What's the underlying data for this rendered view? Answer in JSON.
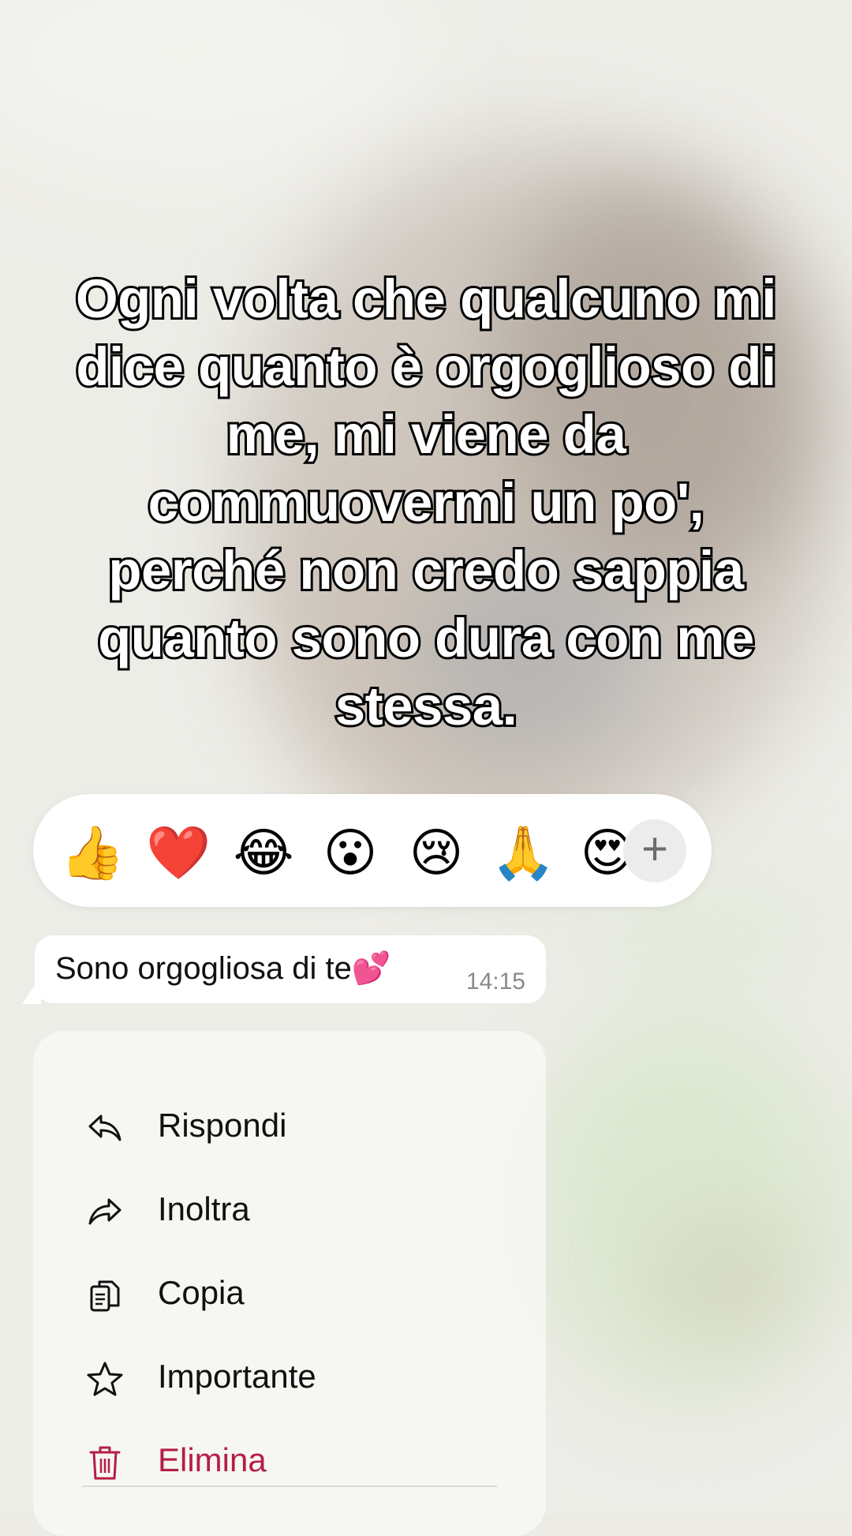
{
  "caption": "Ogni volta che qualcuno mi dice quanto è orgoglioso di me, mi viene da commuovermi un po', perché non credo sappia quanto sono dura con me stessa.",
  "reactions": [
    "👍",
    "❤️",
    "😂",
    "😮",
    "😢",
    "🙏",
    "😍"
  ],
  "reaction_more": "+",
  "message": {
    "text": "Sono orgogliosa di te💕",
    "time": "14:15"
  },
  "menu": {
    "reply": "Rispondi",
    "forward": "Inoltra",
    "copy": "Copia",
    "star": "Importante",
    "delete": "Elimina"
  },
  "colors": {
    "danger": "#b51e45"
  }
}
